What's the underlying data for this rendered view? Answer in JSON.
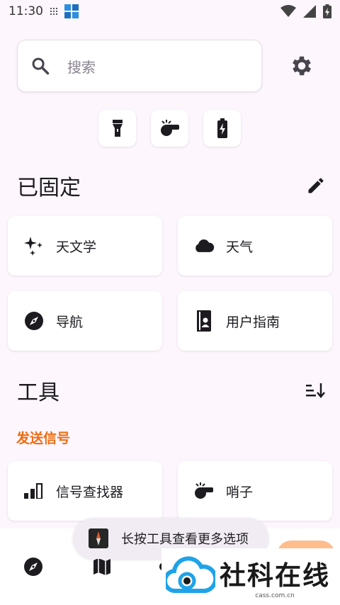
{
  "status_bar": {
    "time": "11:30",
    "icons": [
      "notification-dots-icon",
      "app-notification-icon",
      "wifi-icon",
      "cell-signal-icon",
      "battery-charging-icon"
    ]
  },
  "search": {
    "placeholder": "搜索",
    "icon": "search-icon"
  },
  "settings_icon": "gear-icon",
  "quick_actions": [
    {
      "name": "flashlight",
      "icon": "flashlight-icon"
    },
    {
      "name": "whistle",
      "icon": "whistle-icon"
    },
    {
      "name": "battery",
      "icon": "battery-icon"
    }
  ],
  "pinned": {
    "title": "已固定",
    "edit_icon": "pencil-icon",
    "items": [
      {
        "label": "天文学",
        "icon": "sparkles-icon"
      },
      {
        "label": "天气",
        "icon": "cloud-icon"
      },
      {
        "label": "导航",
        "icon": "compass-icon"
      },
      {
        "label": "用户指南",
        "icon": "user-guide-icon"
      }
    ]
  },
  "tools": {
    "title": "工具",
    "sort_icon": "sort-icon",
    "category": "发送信号",
    "items": [
      {
        "label": "信号查找器",
        "icon": "signal-bars-icon"
      },
      {
        "label": "哨子",
        "icon": "whistle-icon"
      }
    ]
  },
  "toast": {
    "text": "长按工具查看更多选项",
    "icon": "compass-app-icon"
  },
  "bottom_nav": [
    {
      "name": "navigation",
      "icon": "compass-icon"
    },
    {
      "name": "map",
      "icon": "map-icon"
    },
    {
      "name": "weather",
      "icon": "cloud-icon"
    }
  ],
  "watermark": {
    "brand": "社科在线",
    "domain": "cass.com.cn"
  },
  "colors": {
    "background": "#fdf6fd",
    "accent_orange": "#ee6c12",
    "card": "#ffffff",
    "icon_dark": "#1d1b20"
  }
}
